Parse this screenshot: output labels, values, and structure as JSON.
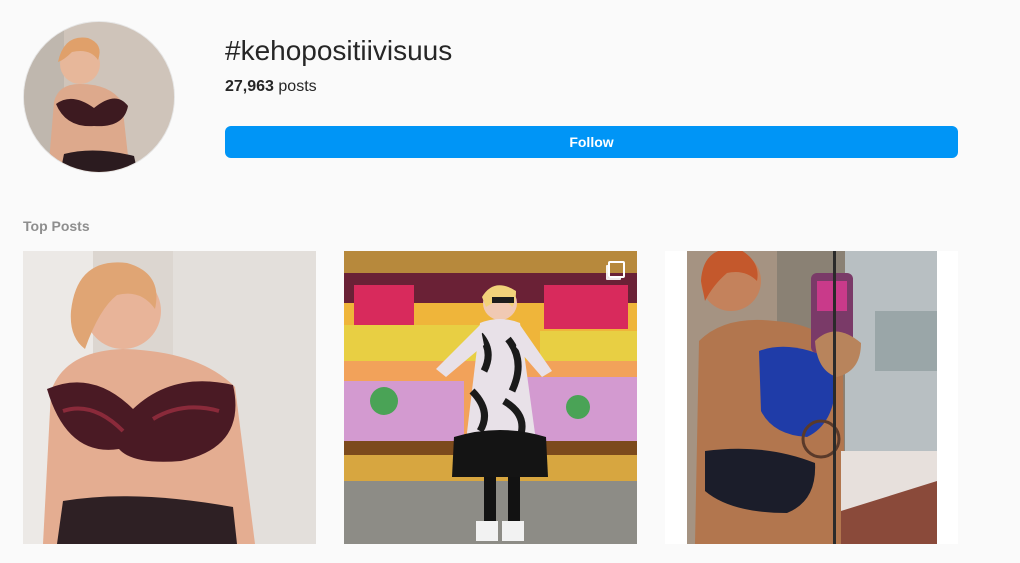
{
  "hashtag": {
    "title": "#kehopositiivisuus",
    "post_count": "27,963",
    "post_label": "posts",
    "follow_label": "Follow"
  },
  "top_posts": {
    "title": "Top Posts",
    "items": [
      {
        "icon": "photo"
      },
      {
        "icon": "photo",
        "overlay_icon": "multiple-photos-icon"
      },
      {
        "icon": "photo"
      }
    ]
  },
  "colors": {
    "background": "#fafafa",
    "follow_button": "#0095f6",
    "text": "#262626",
    "muted": "#8e8e8e"
  }
}
